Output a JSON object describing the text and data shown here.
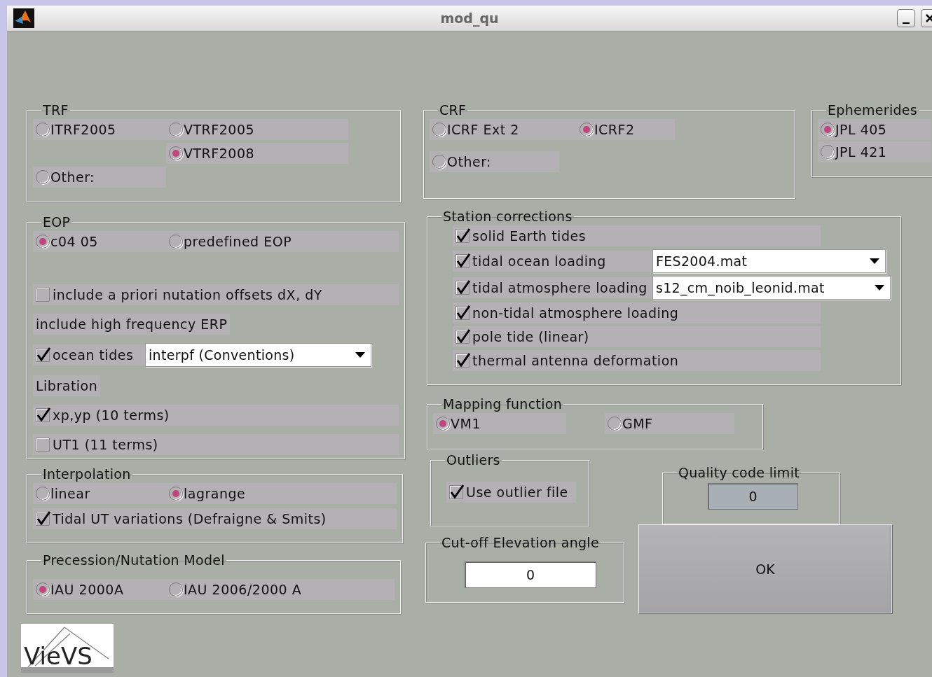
{
  "window": {
    "title": "mod_qu"
  },
  "trf": {
    "title": "TRF",
    "options": [
      {
        "label": "ITRF2005",
        "selected": false
      },
      {
        "label": "VTRF2005",
        "selected": false
      },
      {
        "label": "VTRF2008",
        "selected": true
      },
      {
        "label": "Other:",
        "selected": false
      }
    ]
  },
  "eop": {
    "title": "EOP",
    "options": [
      {
        "label": "c04 05",
        "selected": true
      },
      {
        "label": "predefined EOP",
        "selected": false
      }
    ],
    "nutation": {
      "label": "include a priori nutation offsets dX, dY",
      "checked": false
    },
    "hf_label": "include high frequency ERP",
    "ocean_tides": {
      "label": "ocean tides",
      "checked": true,
      "value": "interpf (Conventions)"
    },
    "libration_label": "Libration",
    "libration": [
      {
        "label": "xp,yp (10 terms)",
        "checked": true
      },
      {
        "label": "UT1 (11 terms)",
        "checked": false
      }
    ]
  },
  "interpolation": {
    "title": "Interpolation",
    "options": [
      {
        "label": "linear",
        "selected": false
      },
      {
        "label": "lagrange",
        "selected": true
      }
    ],
    "tidal_ut": {
      "label": "Tidal UT variations (Defraigne & Smits)",
      "checked": true
    }
  },
  "precession": {
    "title": "Precession/Nutation Model",
    "options": [
      {
        "label": "IAU 2000A",
        "selected": true
      },
      {
        "label": "IAU 2006/2000 A",
        "selected": false
      }
    ]
  },
  "crf": {
    "title": "CRF",
    "options": [
      {
        "label": "ICRF Ext 2",
        "selected": false
      },
      {
        "label": "ICRF2",
        "selected": true
      },
      {
        "label": "Other:",
        "selected": false
      }
    ]
  },
  "ephemerides": {
    "title": "Ephemerides",
    "options": [
      {
        "label": "JPL 405",
        "selected": true
      },
      {
        "label": "JPL 421",
        "selected": false
      }
    ]
  },
  "station": {
    "title": "Station corrections",
    "items": [
      {
        "label": "solid Earth tides",
        "checked": true
      },
      {
        "label": "tidal ocean loading",
        "checked": true,
        "value": "FES2004.mat"
      },
      {
        "label": "tidal atmosphere loading",
        "checked": true,
        "value": "s12_cm_noib_leonid.mat"
      },
      {
        "label": "non-tidal atmosphere loading",
        "checked": true
      },
      {
        "label": "pole tide (linear)",
        "checked": true
      },
      {
        "label": "thermal antenna deformation",
        "checked": true
      }
    ]
  },
  "mapping": {
    "title": "Mapping function",
    "options": [
      {
        "label": "VM1",
        "selected": true
      },
      {
        "label": "GMF",
        "selected": false
      }
    ]
  },
  "outliers": {
    "title": "Outliers",
    "checkbox": {
      "label": "Use outlier file",
      "checked": true
    }
  },
  "quality": {
    "title": "Quality code limit",
    "value": "0"
  },
  "cutoff": {
    "title": "Cut-off Elevation angle",
    "value": "0"
  },
  "ok_button": "OK",
  "logo": {
    "text": "VieVS"
  }
}
